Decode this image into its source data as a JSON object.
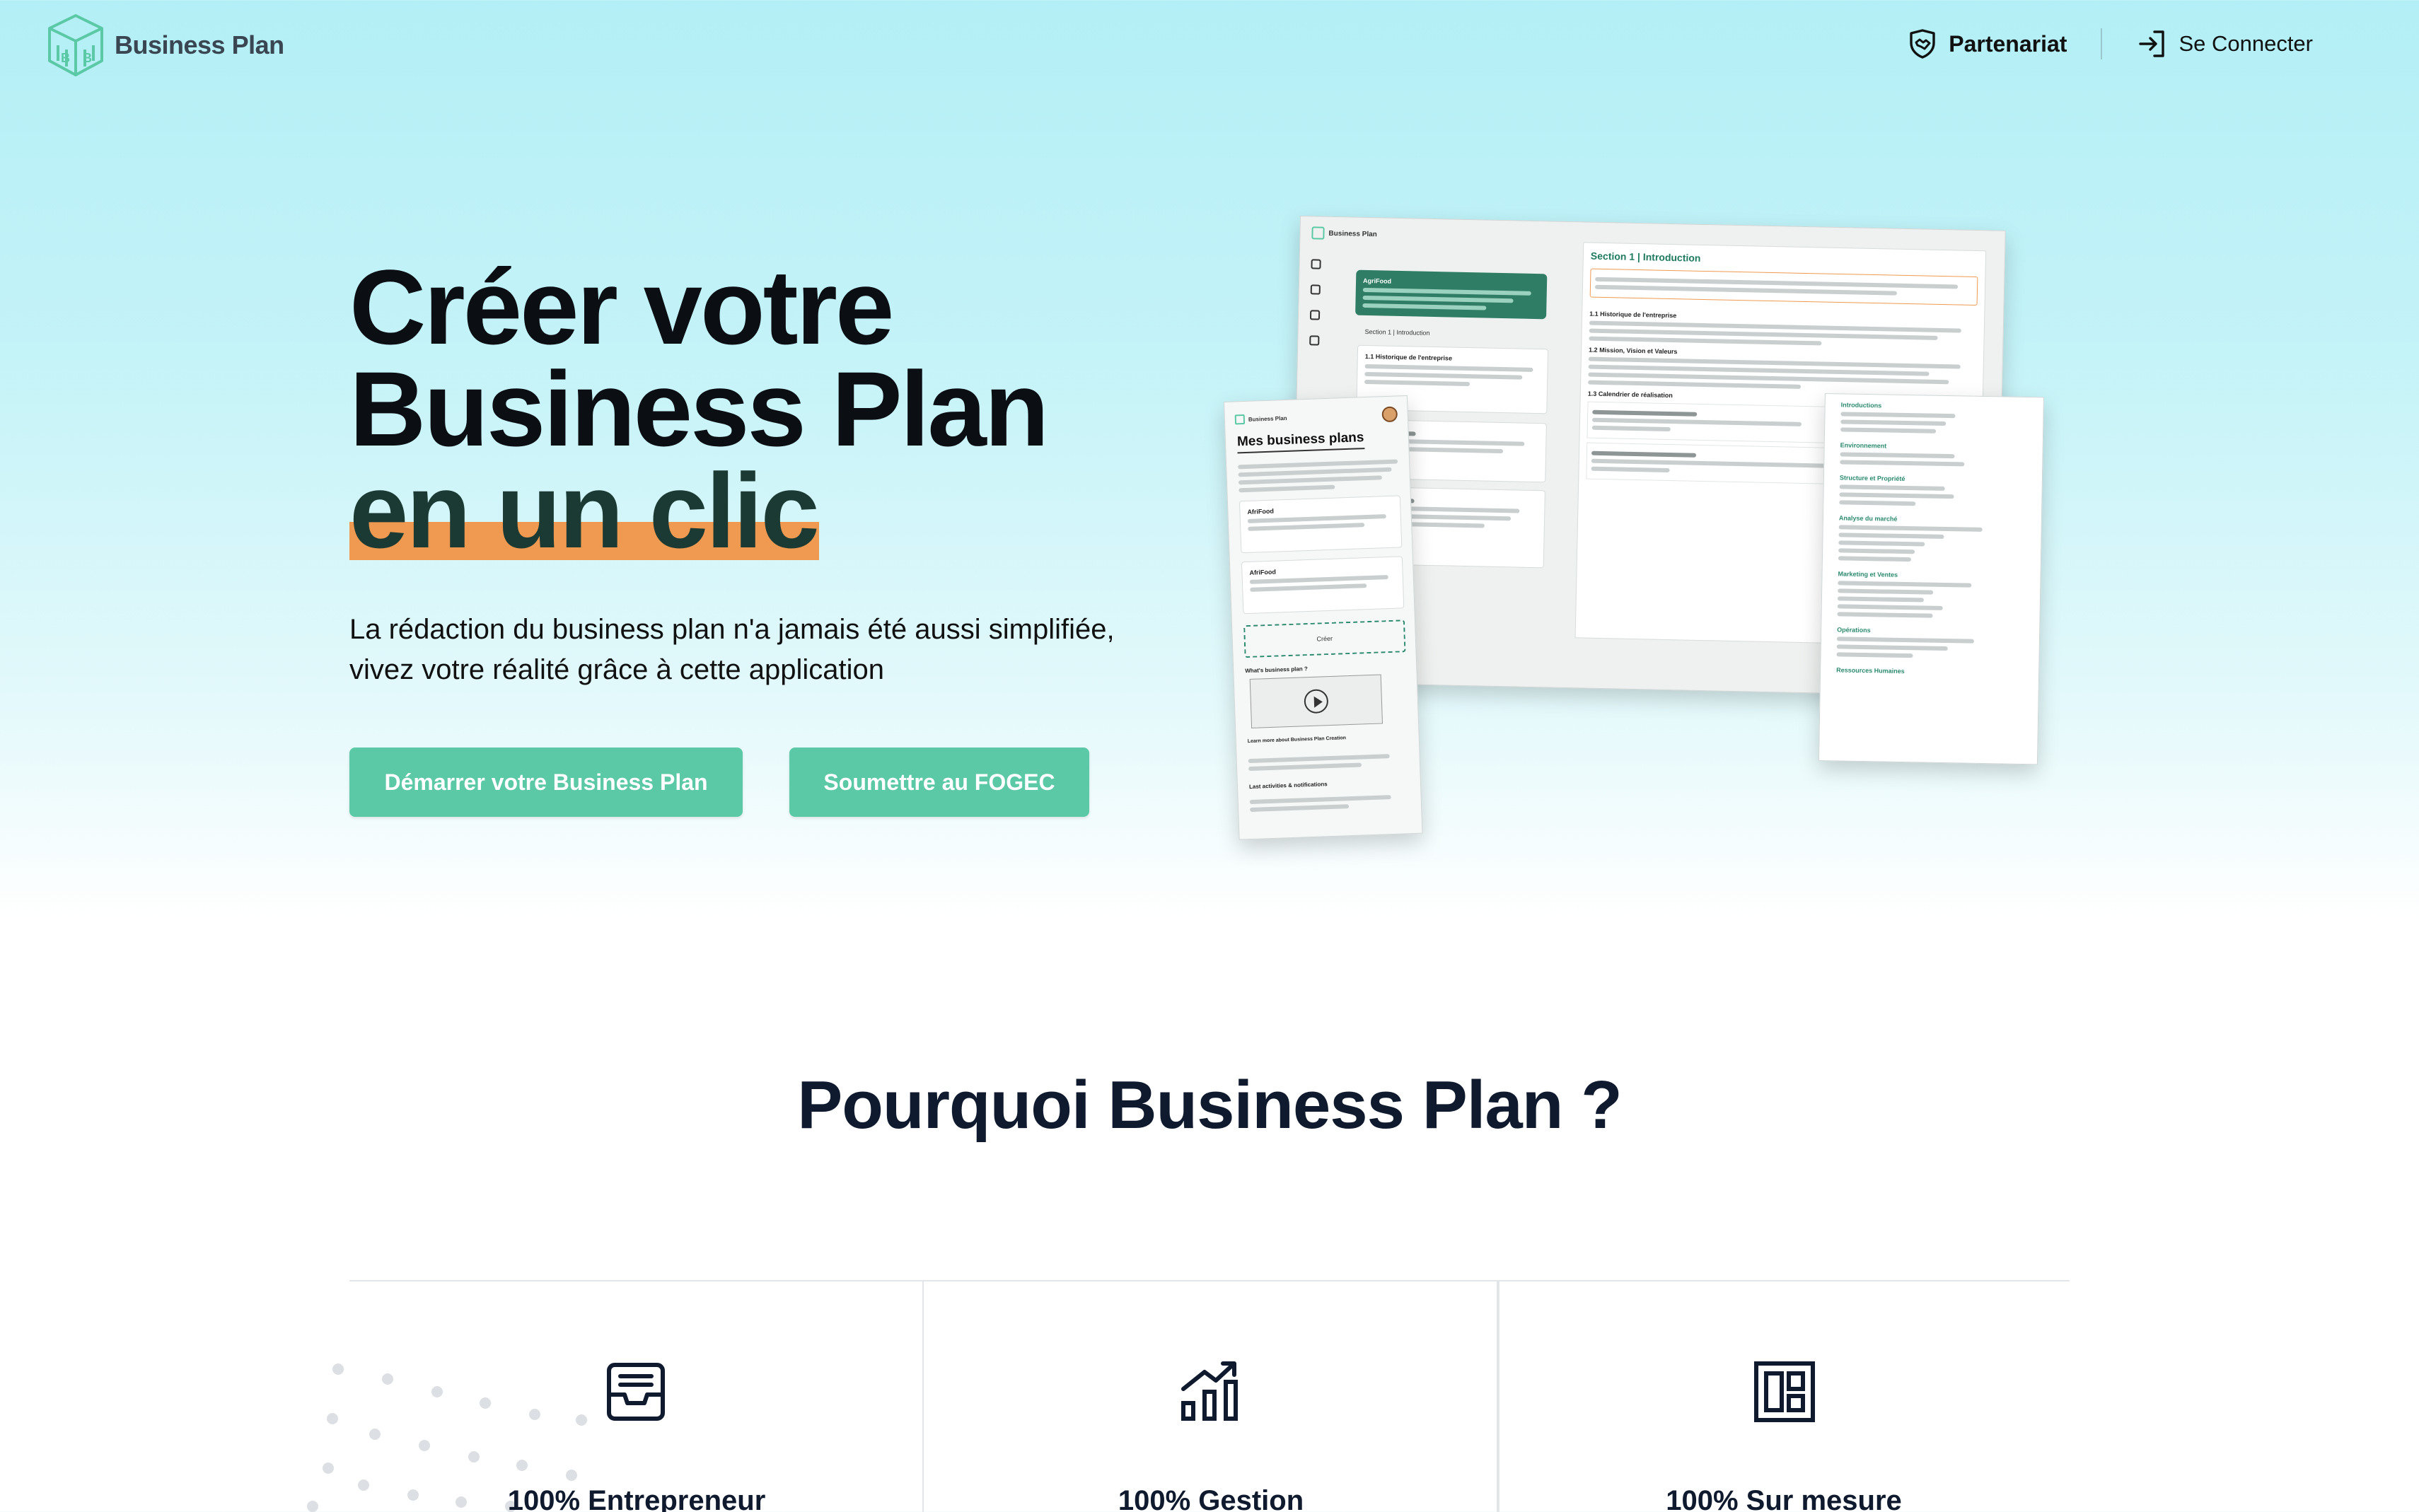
{
  "nav": {
    "logo_text": "Business Plan",
    "partner_label": "Partenariat",
    "login_label": "Se Connecter"
  },
  "hero": {
    "title_line1": "Créer votre",
    "title_line2": "Business Plan",
    "title_line3": "en un clic",
    "subtitle_line1": "La rédaction du business plan n'a jamais été aussi simplifiée,",
    "subtitle_line2": "vivez votre réalité grâce à cette application",
    "cta_start": "Démarrer votre Business Plan",
    "cta_fogec": "Soumettre au FOGEC",
    "highlight_color": "#ef9a50",
    "button_color": "#5bc9a5"
  },
  "mockups": {
    "desktop_brand": "Business Plan",
    "desktop_section": "Section 1 | Introduction",
    "desktop_subhead_1": "1.1 Historique de l'entreprise",
    "desktop_subhead_2": "1.2 Mission, Vision et Valeurs",
    "desktop_subhead_3": "1.3 Calendrier de réalisation",
    "desktop_green_label": "AgriFood",
    "phone_brand": "Business Plan",
    "phone_title": "Mes business plans",
    "phone_item_1": "AfriFood",
    "phone_item_2": "AfriFood",
    "phone_create": "Créer",
    "phone_what": "What's business plan ?",
    "phone_learn": "Learn more about Business Plan Creation",
    "phone_activities": "Last activities & notifications",
    "toc_heads": [
      "Introductions",
      "Environnement",
      "Structure et Propriété",
      "Analyse du marché",
      "Marketing et Ventes",
      "Opérations",
      "Ressources Humaines"
    ]
  },
  "why": {
    "title": "Pourquoi Business Plan ?",
    "features": [
      {
        "title": "100% Entrepreneur",
        "icon": "inbox-icon"
      },
      {
        "title": "100% Gestion",
        "icon": "chart-growth-icon"
      },
      {
        "title": "100% Sur mesure",
        "icon": "layout-icon"
      }
    ]
  }
}
